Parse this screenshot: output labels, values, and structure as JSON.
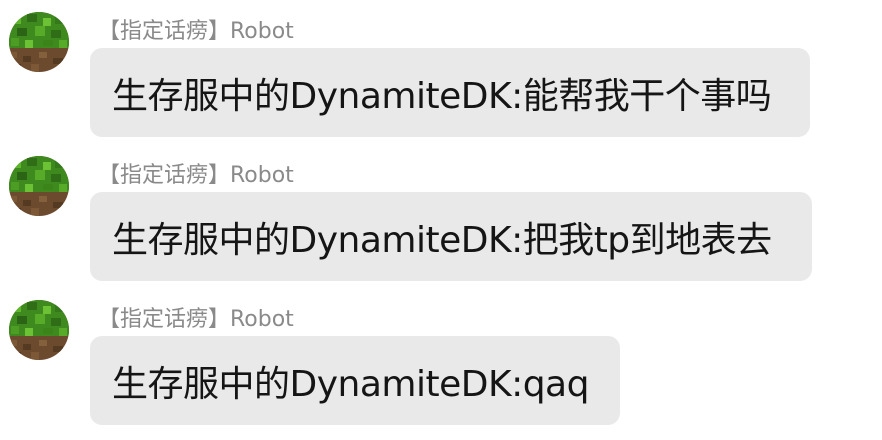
{
  "messages": [
    {
      "sender": "【指定话痨】Robot",
      "text": "生存服中的DynamiteDK:能帮我干个事吗"
    },
    {
      "sender": "【指定话痨】Robot",
      "text": "生存服中的DynamiteDK:把我tp到地表去"
    },
    {
      "sender": "【指定话痨】Robot",
      "text": "生存服中的DynamiteDK:qaq"
    }
  ],
  "colors": {
    "bubble": "#e9e9e9",
    "sender_text": "#8a8a8a",
    "message_text": "#151515",
    "avatar_grass": "#3e8a1f",
    "avatar_dirt": "#6b4a2e"
  },
  "icons": {
    "avatar": "minecraft-grass-block-icon"
  }
}
